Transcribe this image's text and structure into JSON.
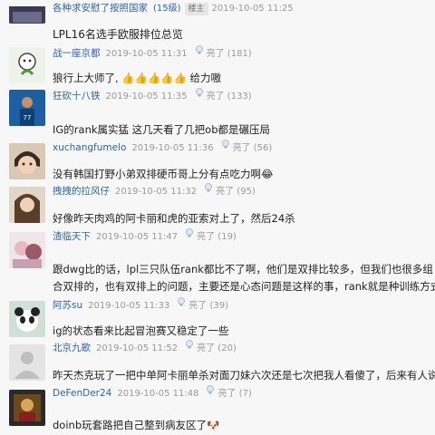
{
  "comments": [
    {
      "user": "各种求安慰了按照国家",
      "level": "(15级)",
      "badge": "楼主",
      "time": "2019-10-05 11:25",
      "content": "LPL16名选手欧服排位总览"
    },
    {
      "user": "战一座京都",
      "time": "2019-10-05 11:31",
      "likes": "亮了 (181)",
      "content": "狼行上大师了, 👍👍👍👍👍 给力嗷"
    },
    {
      "user": "狂砍十八铁",
      "time": "2019-10-05 11:35",
      "likes": "亮了 (133)",
      "content": "IG的rank属实猛 这几天看了几把ob都是碾压局"
    },
    {
      "user": "xuchangfumelo",
      "time": "2019-10-05 11:36",
      "likes": "亮了 (56)",
      "content": "没有韩国打野小弟双排硬币哥上分有点吃力啊😂"
    },
    {
      "user": "拽拽的拉风仔",
      "time": "2019-10-05 11:32",
      "likes": "亮了 (95)",
      "content": "好像昨天肉鸡的阿卡丽和虎的亚索对上了，然后24杀"
    },
    {
      "user": "渣临天下",
      "time": "2019-10-05 11:47",
      "likes": "亮了 (19)",
      "content": "跟dwg比的话，lpl三只队伍rank都比不了啊，他们是双排比较多，但我们也很多组合双排的，也有双排上的问题，主要还是心态问题是这样的事，rank就是种训练方式分数不是目的。"
    },
    {
      "user": "阿苏su",
      "time": "2019-10-05 11:33",
      "likes": "亮了 (39)",
      "content": "ig的状态看来比起冒泡赛又稳定了一些"
    },
    {
      "user": "北京九歌",
      "time": "2019-10-05 11:52",
      "likes": "亮了 (20)",
      "content": "昨天杰克玩了一把中单阿卡丽单杀对面刀妹六次还是七次把我人看傻了，后来有人说"
    },
    {
      "user": "DeFenDer24",
      "time": "2019-10-05 11:48",
      "likes": "亮了 (7)",
      "content": "doinb玩套路把自己整到病友区了🐶"
    }
  ],
  "colors": {
    "username": "#2d64b3",
    "meta": "#999999",
    "badge_bg": "#e6e6e6",
    "page_bg": "#f7f7f7"
  },
  "icons": {
    "like": "lightbulb-icon"
  }
}
